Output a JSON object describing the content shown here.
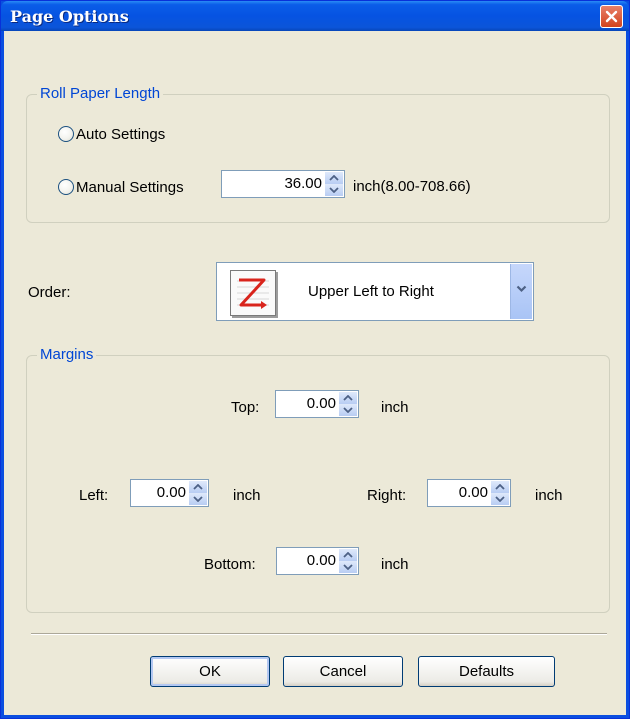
{
  "window": {
    "title": "Page Options"
  },
  "roll_paper": {
    "group_label": "Roll Paper Length",
    "auto_label": "Auto Settings",
    "manual_label": "Manual Settings",
    "length_value": "36.00",
    "range_label": "inch(8.00-708.66)"
  },
  "order": {
    "label": "Order:",
    "selected": "Upper Left to Right",
    "icon": "z-order-icon"
  },
  "margins": {
    "group_label": "Margins",
    "top_label": "Top:",
    "top_value": "0.00",
    "left_label": "Left:",
    "left_value": "0.00",
    "right_label": "Right:",
    "right_value": "0.00",
    "bottom_label": "Bottom:",
    "bottom_value": "0.00",
    "unit": "inch"
  },
  "buttons": {
    "ok": "OK",
    "cancel": "Cancel",
    "defaults": "Defaults"
  },
  "colors": {
    "title_bar": "#0653e2",
    "group_label": "#0046d5",
    "dialog_bg": "#ece9d8"
  }
}
